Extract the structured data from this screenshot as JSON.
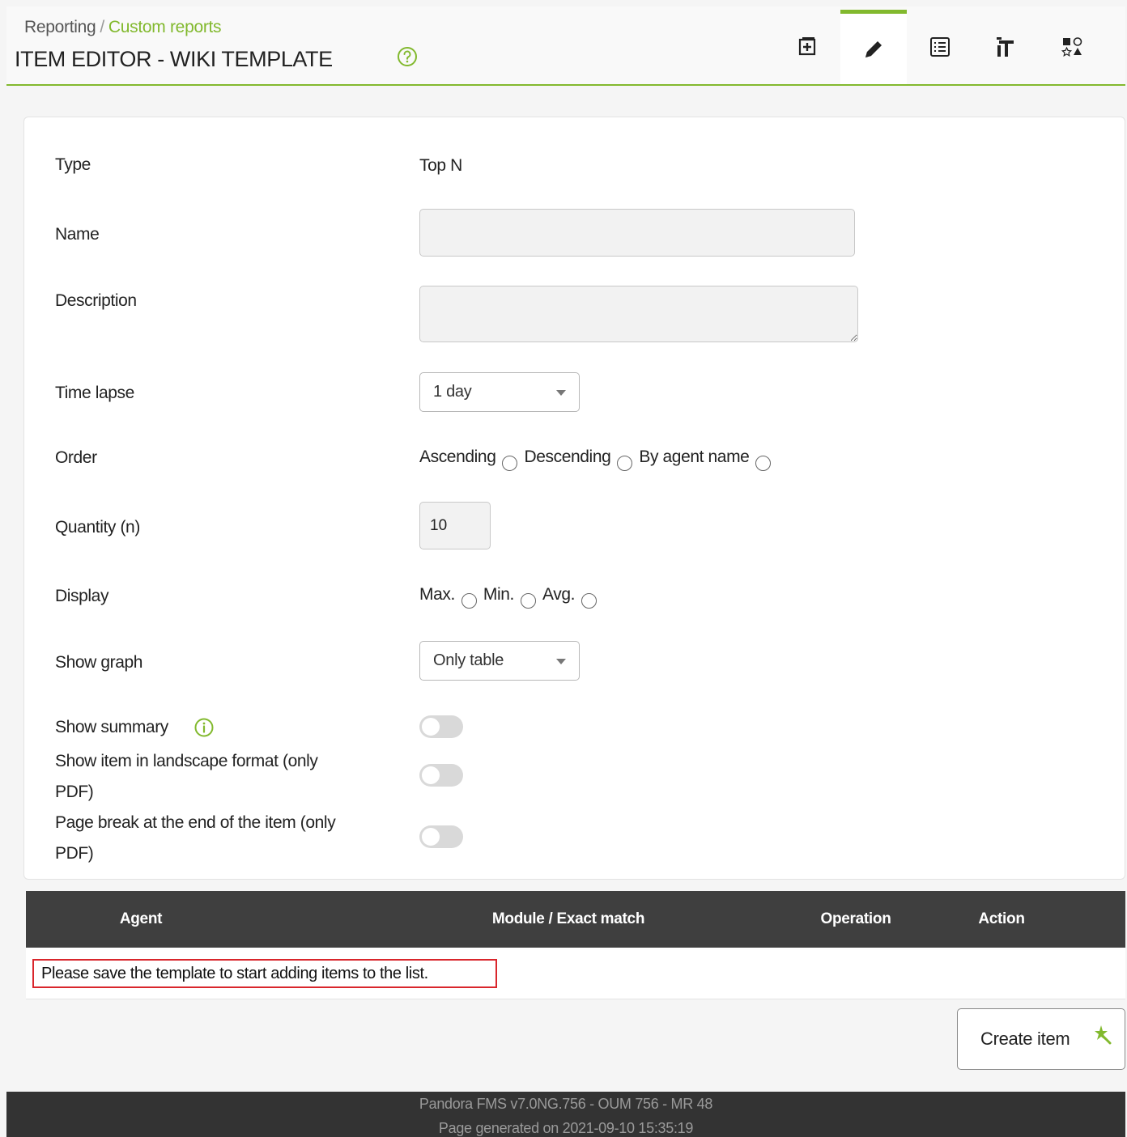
{
  "breadcrumb": {
    "root": "Reporting",
    "separator": "/",
    "current": "Custom reports"
  },
  "page_title": "ITEM EDITOR - WIKI TEMPLATE",
  "header_tabs": [
    {
      "icon": "add-box-icon",
      "active": false
    },
    {
      "icon": "pencil-icon",
      "active": true
    },
    {
      "icon": "list-icon",
      "active": false
    },
    {
      "icon": "wizard-icon",
      "active": false
    },
    {
      "icon": "shapes-icon",
      "active": false
    }
  ],
  "form": {
    "type": {
      "label": "Type",
      "value": "Top N"
    },
    "name": {
      "label": "Name",
      "value": ""
    },
    "description": {
      "label": "Description",
      "value": ""
    },
    "time_lapse": {
      "label": "Time lapse",
      "value": "1 day"
    },
    "order": {
      "label": "Order",
      "options": [
        "Ascending",
        "Descending",
        "By agent name"
      ]
    },
    "quantity": {
      "label": "Quantity (n)",
      "value": "10"
    },
    "display": {
      "label": "Display",
      "options": [
        "Max.",
        "Min.",
        "Avg."
      ]
    },
    "show_graph": {
      "label": "Show graph",
      "value": "Only table"
    },
    "show_summary": {
      "label": "Show summary",
      "enabled": false
    },
    "landscape": {
      "label_line1": "Show item in landscape format (only",
      "label_line2": "PDF)",
      "enabled": false
    },
    "page_break": {
      "label_line1": "Page break at the end of the item (only",
      "label_line2": "PDF)",
      "enabled": false
    }
  },
  "table": {
    "columns": [
      "Agent",
      "Module / Exact match",
      "Operation",
      "Action"
    ],
    "empty_notice": "Please save the template to start adding items to the list."
  },
  "create_button": {
    "label": "Create item"
  },
  "footer": {
    "version": "Pandora FMS v7.0NG.756 - OUM 756 - MR 48",
    "generated": "Page generated on 2021-09-10 15:35:19"
  },
  "colors": {
    "accent": "#82b92e",
    "header_dark": "#3f3f3f",
    "notice_border": "#d9262c",
    "footer_bg": "#333333"
  }
}
